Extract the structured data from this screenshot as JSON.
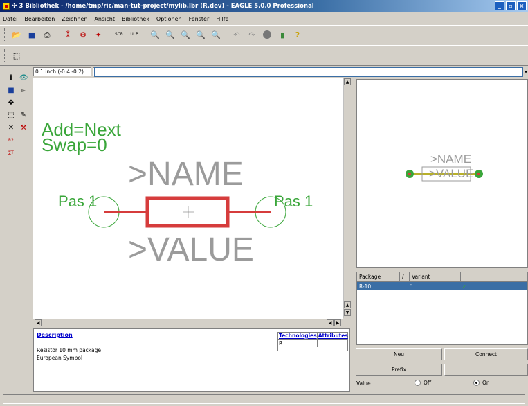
{
  "window": {
    "title": "3 Bibliothek - /home/tmp/ric/man-tut-project/mylib.lbr (R.dev) - EAGLE 5.0.0 Professional",
    "buttons": [
      "_",
      "▫",
      "×"
    ]
  },
  "menu": [
    "Datei",
    "Bearbeiten",
    "Zeichnen",
    "Ansicht",
    "Bibliothek",
    "Optionen",
    "Fenster",
    "Hilfe"
  ],
  "toolbar1_icons": [
    "open-icon",
    "save-icon",
    "print-icon",
    "cam-icon",
    "script-icon",
    "ulp-icon",
    "scr-icon",
    "ulp2-icon",
    "zoom-fit-icon",
    "zoom-in-icon",
    "zoom-out-icon",
    "zoom-redraw-icon",
    "zoom-select-icon",
    "undo-icon",
    "redo-icon",
    "stop-icon",
    "go-icon",
    "help-icon"
  ],
  "coords": "0.1 inch (-0.4 -0.2)",
  "command_value": "",
  "canvas": {
    "add_label": "Add=Next",
    "swap_label": "Swap=0",
    "name_label": ">NAME",
    "value_label": ">VALUE",
    "pin_left": "Pas 1",
    "pin_right": "Pas 1",
    "colors": {
      "green": "#3aa63a",
      "red": "#d63c3c",
      "gray": "#9b9b9b"
    }
  },
  "description": {
    "title": "Description",
    "line1": "Resistor 10 mm package",
    "line2": "European Symbol",
    "tech_header": "Technologies",
    "attr_header": "Attributes",
    "tech_value": "R"
  },
  "preview": {
    "name_label": ">NAME",
    "value_label": ">VALUE"
  },
  "packages": {
    "headers": [
      "Package",
      "/",
      "Variant"
    ],
    "rows": [
      {
        "package": "R-10",
        "variant": "''",
        "check": "✓"
      }
    ]
  },
  "buttons": {
    "new": "Neu",
    "connect": "Connect",
    "prefix": "Prefix",
    "value": "Value",
    "off": "Off",
    "on": "On"
  }
}
